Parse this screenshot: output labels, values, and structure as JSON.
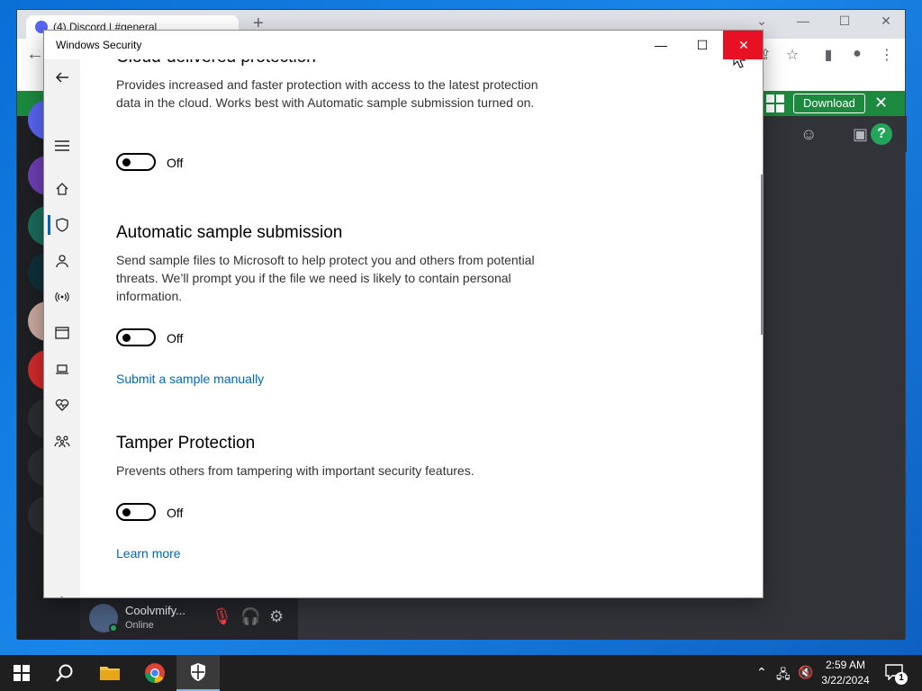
{
  "browser": {
    "tab_title": "(4) Discord | #general",
    "download_bar": {
      "button_label": "Download"
    }
  },
  "discord": {
    "user": {
      "name": "Coolvmify...",
      "status": "Online"
    }
  },
  "window": {
    "title": "Windows Security",
    "controls": {
      "minimize": "—",
      "maximize": "☐",
      "close": "✕"
    }
  },
  "sections": [
    {
      "title": "Cloud-delivered protection",
      "description": "Provides increased and faster protection with access to the latest protection data in the cloud. Works best with Automatic sample submission turned on.",
      "toggle_state": "Off"
    },
    {
      "title": "Automatic sample submission",
      "description": "Send sample files to Microsoft to help protect you and others from potential threats. We’ll prompt you if the file we need is likely to contain personal information.",
      "toggle_state": "Off",
      "link": "Submit a sample manually"
    },
    {
      "title": "Tamper Protection",
      "description": "Prevents others from tampering with important security features.",
      "toggle_state": "Off",
      "link": "Learn more"
    }
  ],
  "taskbar": {
    "time": "2:59 AM",
    "date": "3/22/2024",
    "notification_count": "1"
  },
  "colors": {
    "accent_link": "#0067b8",
    "close_button": "#e81123",
    "download_bar": "#1b8a3e"
  }
}
